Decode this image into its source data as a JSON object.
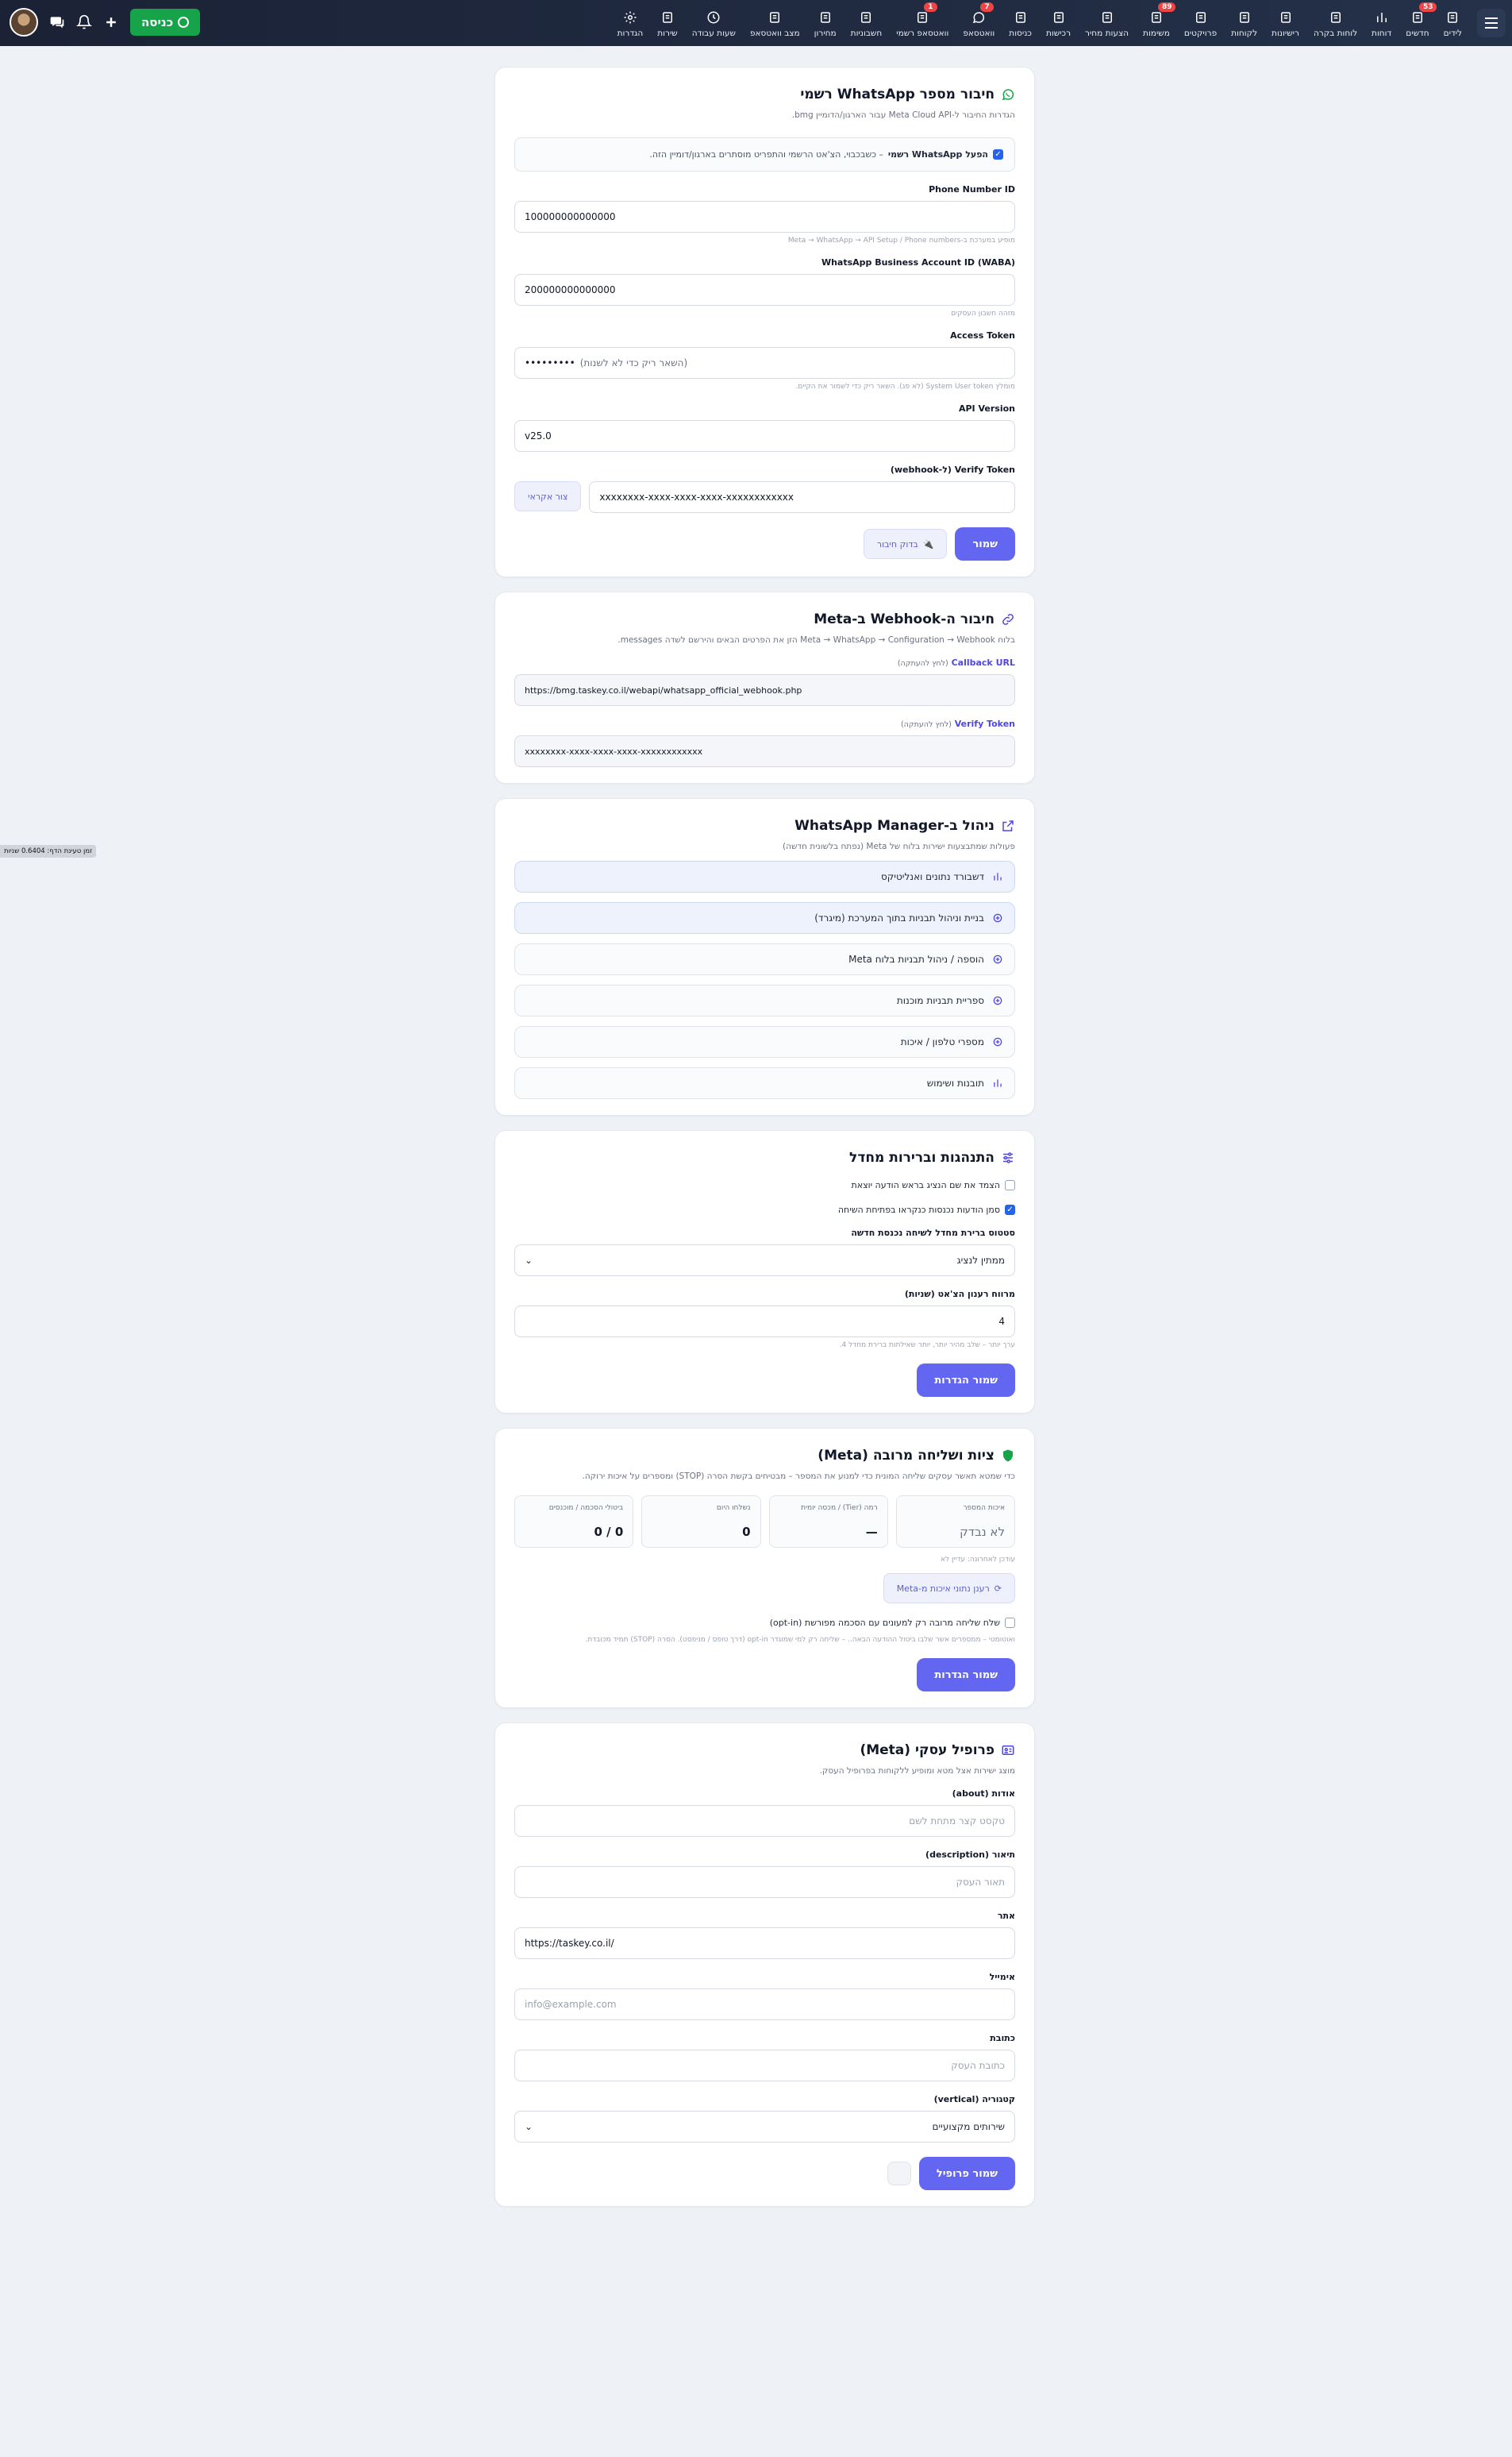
{
  "nav": {
    "menu_label": "תפריט",
    "items": [
      {
        "label": "לידים",
        "icon": "person-icon",
        "badge": ""
      },
      {
        "label": "חדשים",
        "icon": "person-plus-icon",
        "badge": "53"
      },
      {
        "label": "דוחות",
        "icon": "bar-chart-icon",
        "badge": ""
      },
      {
        "label": "לוחות בקרה",
        "icon": "gauge-icon",
        "badge": ""
      },
      {
        "label": "רישיונות",
        "icon": "document-icon",
        "badge": ""
      },
      {
        "label": "לקוחות",
        "icon": "customer-icon",
        "badge": ""
      },
      {
        "label": "פרויקטים",
        "icon": "projects-icon",
        "badge": ""
      },
      {
        "label": "משימות",
        "icon": "check-square-icon",
        "badge": "89"
      },
      {
        "label": "הצעות מחיר",
        "icon": "quote-icon",
        "badge": ""
      },
      {
        "label": "רכישות",
        "icon": "purchase-icon",
        "badge": ""
      },
      {
        "label": "כניסות",
        "icon": "entries-icon",
        "badge": ""
      },
      {
        "label": "וואטסאפ",
        "icon": "whatsapp-icon",
        "badge": "7"
      },
      {
        "label": "וואטסאפ רשמי",
        "icon": "whatsapp-official-icon",
        "badge": "1"
      },
      {
        "label": "חשבוניות",
        "icon": "invoice-icon",
        "badge": ""
      },
      {
        "label": "מחירון",
        "icon": "pricelist-icon",
        "badge": ""
      },
      {
        "label": "מצב וואטסאפ",
        "icon": "whatsapp-status-icon",
        "badge": ""
      },
      {
        "label": "שעות עבודה",
        "icon": "clock-icon",
        "badge": ""
      },
      {
        "label": "שירות",
        "icon": "wrench-icon",
        "badge": ""
      },
      {
        "label": "הגדרות",
        "icon": "gear-icon",
        "badge": ""
      }
    ],
    "enter_button": "כניסה"
  },
  "side_badge": "זמן טעינת הדף: 0.6404 שניות",
  "connect": {
    "title": "חיבור מספר WhatsApp רשמי",
    "subtitle": "הגדרות החיבור ל-Meta Cloud API עבור הארגון/הדומיין bmg.",
    "enable_label": "הפעל WhatsApp רשמי",
    "enable_desc": " – כשבכבוי, הצ'אט הרשמי והתפריט מוסתרים בארגון/דומיין הזה.",
    "phone_id_label": "Phone Number ID",
    "phone_id_value": "100000000000000",
    "phone_id_hint": "מופיע במערכת ב-Meta → WhatsApp → API Setup / Phone numbers",
    "waba_label": "WhatsApp Business Account ID (WABA)",
    "waba_value": "200000000000000",
    "waba_hint": "מזהה חשבון העסקים",
    "token_label": "Access Token",
    "token_value": "•••••••••",
    "token_placeholder": "(השאר ריק כדי לא לשנות)",
    "token_hint": "מומלץ System User token (לא פג). השאר ריק כדי לשמור את הקיים.",
    "api_label": "API Version",
    "api_value": "v25.0",
    "verify_label": "Verify Token (ל-webhook)",
    "verify_value": "xxxxxxxx-xxxx-xxxx-xxxx-xxxxxxxxxxxx",
    "generate_button": "צור אקראי",
    "save_button": "שמור",
    "test_button": "בדוק חיבור"
  },
  "webhook": {
    "title": "חיבור ה-Webhook ב-Meta",
    "subtitle": "בלוח Meta → WhatsApp → Configuration → Webhook הזן את הפרטים הבאים והירשם לשדה messages.",
    "callback_label": "Callback URL",
    "copy_hint": "(לחץ להעתקה)",
    "callback_value": "https://bmg.taskey.co.il/webapi/whatsapp_official_webhook.php",
    "verify_label": "Verify Token",
    "verify_value": "xxxxxxxx-xxxx-xxxx-xxxx-xxxxxxxxxxxx"
  },
  "manager": {
    "title": "ניהול ב-WhatsApp Manager",
    "subtitle": "פעולות שמתבצעות ישירות בלוח של Meta (נפתח בלשונית חדשה)",
    "buttons": [
      {
        "label": "דשבורד נתונים ואנליטיקס",
        "icon": "bar-chart-icon",
        "hl": true
      },
      {
        "label": "בניית וניהול תבניות בתוך המערכת (מיגרד)",
        "icon": "magic-wand-icon",
        "hl": true
      },
      {
        "label": "הוספה / ניהול תבניות בלוח Meta",
        "icon": "plus-circle-icon",
        "hl": false
      },
      {
        "label": "ספריית תבניות מוכנות",
        "icon": "book-icon",
        "hl": false
      },
      {
        "label": "מספרי טלפון / איכות",
        "icon": "phone-icon",
        "hl": false
      },
      {
        "label": "תובנות ושימוש",
        "icon": "bar-chart-icon",
        "hl": false
      }
    ]
  },
  "behavior": {
    "title": "התנהגות וברירות מחדל",
    "chk1": "הצמד את שם הנציג בראש הודעה יוצאת",
    "chk2": "סמן הודעות נכנסות כנקראו בפתיחת השיחה",
    "status_label": "סטטוס ברירת מחדל לשיחה נכנסת חדשה",
    "status_value": "ממתין לנציג",
    "refresh_label": "מרווח רענון הצ'אט (שניות)",
    "refresh_value": "4",
    "refresh_hint": "ערך יותר – שלב מהיר יותר, יותר שאילתות ברירת מחדל 4.",
    "save_button": "שמור הגדרות"
  },
  "compliance": {
    "title": "ציות ושליחה מרובה (Meta)",
    "subtitle": "כדי שמטא תאשר עסקים שליחה המונית כדי למנוע את המספר – מבטיחים בקשת הסרה (STOP) ומספרים על איכות ירוקה.",
    "stats": [
      {
        "title": "איכות המספר",
        "value": "לא נבדק",
        "gray": true
      },
      {
        "title": "רמה (Tier) / מכסה יומית",
        "value": "—",
        "gray": false
      },
      {
        "title": "נשלחו היום",
        "value": "0",
        "gray": false
      },
      {
        "title": "ביטולי הסכמה / מוכנסים",
        "value": "0 / 0",
        "gray": false
      }
    ],
    "last_update": "עודכן לאחרונה: עדיין לא",
    "refresh_button": "רענן נתוני איכות מ-Meta",
    "optin_label": "שלח שליחה מרובה רק למעונים עם הסכמה מפורשת (opt-in)",
    "optin_hint": "ואוטומטי – ממספרים אשר שלבו ביטול ההודעה הבאה.. – שליחה רק למי שמוגדר opt-in (דרך טופס / מניפסט). הסרה (STOP) תמיד מכובדת.",
    "save_button": "שמור הגדרות"
  },
  "profile": {
    "title": "פרופיל עסקי (Meta)",
    "subtitle": "מוצג ישירות אצל מטא ומופיע ללקוחות בפרופיל העסק.",
    "about_label": "אודות (about)",
    "about_placeholder": "טקסט קצר מתחת לשם",
    "desc_label": "תיאור (description)",
    "desc_placeholder": "תאור העסק",
    "site_label": "אתר",
    "site_value": "https://taskey.co.il/",
    "email_label": "אימייל",
    "email_placeholder": "info@example.com",
    "address_label": "כתובת",
    "address_placeholder": "כתובת העסק",
    "category_label": "קטגוריה (vertical)",
    "category_value": "שירותים מקצועיים",
    "save_button": "שמור פרופיל"
  }
}
